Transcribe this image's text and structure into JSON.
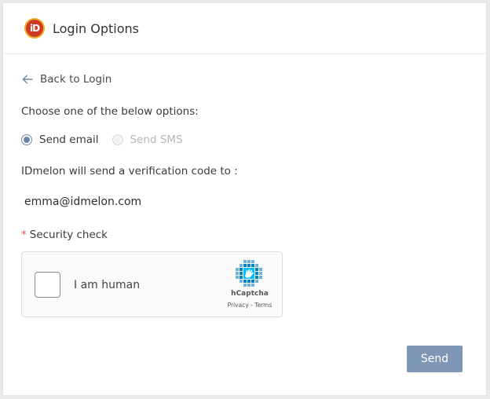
{
  "header": {
    "logo_text": "iD",
    "title": "Login Options"
  },
  "back": {
    "label": "Back to Login"
  },
  "prompt": "Choose one of the below options:",
  "options": [
    {
      "label": "Send email",
      "selected": true,
      "enabled": true
    },
    {
      "label": "Send SMS",
      "selected": false,
      "enabled": false
    }
  ],
  "verify_text": "IDmelon will send a verification code to :",
  "email": "emma@idmelon.com",
  "security": {
    "required_mark": "*",
    "label": "Security check"
  },
  "captcha": {
    "label": "I am human",
    "brand": "hCaptcha",
    "privacy": "Privacy",
    "separator": " - ",
    "terms": "Terms"
  },
  "send_button": "Send",
  "colors": {
    "accent": "#7f97b7",
    "radio": "#6f86a8",
    "logo_red": "#cf3a24",
    "logo_ring": "#f2b12c",
    "required": "#e55353"
  }
}
